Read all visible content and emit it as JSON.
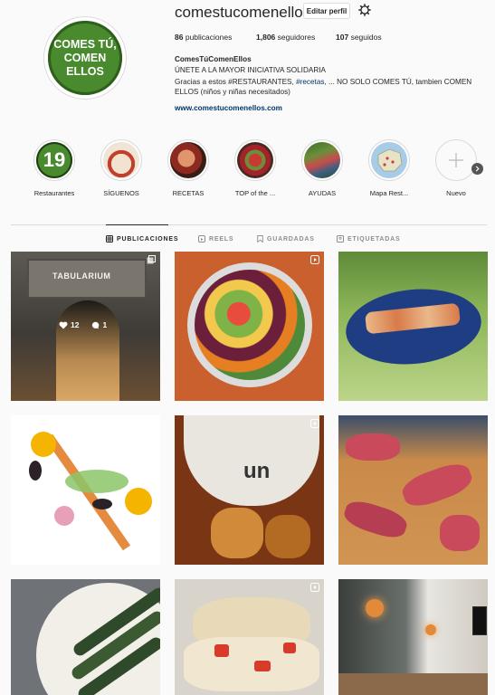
{
  "profile": {
    "username": "comestucomenellos",
    "edit_label": "Editar perfil",
    "avatar_text_1": "COMES TÚ,",
    "avatar_text_2": "COMEN ELLOS",
    "posts_count": "86",
    "posts_label": "publicaciones",
    "followers_count": "1,806",
    "followers_label": "seguidores",
    "following_count": "107",
    "following_label": "seguidos",
    "display_name": "ComesTúComenEllos",
    "bio_line1": "ÚNETE A LA MAYOR INICIATIVA SOLIDARIA",
    "bio_line2_a": "Gracias a estos #RESTAURANTES, ",
    "bio_line2_tag": "#recetas",
    "bio_line2_b": ", ... NO SOLO COMES TÚ, tambien COMEN ELLOS (niños y niñas necesitados)",
    "website": "www.comestucomenellos.com"
  },
  "highlights": [
    {
      "label": "Restaurantes",
      "badge": "19"
    },
    {
      "label": "SÍGUENOS"
    },
    {
      "label": "RECETAS"
    },
    {
      "label": "TOP of the ..."
    },
    {
      "label": "AYUDAS"
    },
    {
      "label": "Mapa Rest..."
    },
    {
      "label": "Nuevo"
    }
  ],
  "tabs": [
    {
      "label": "PUBLICACIONES"
    },
    {
      "label": "REELS"
    },
    {
      "label": "GUARDADAS"
    },
    {
      "label": "ETIQUETADAS"
    }
  ],
  "posts": [
    {
      "likes": "12",
      "comments": "1",
      "sign_text": "TABULARIUM"
    },
    {},
    {},
    {},
    {
      "cup_text": "un"
    },
    {},
    {},
    {},
    {}
  ],
  "colors": {
    "accent": "#0095f6",
    "link": "#00376b",
    "brand_green": "#4a8a2f"
  }
}
